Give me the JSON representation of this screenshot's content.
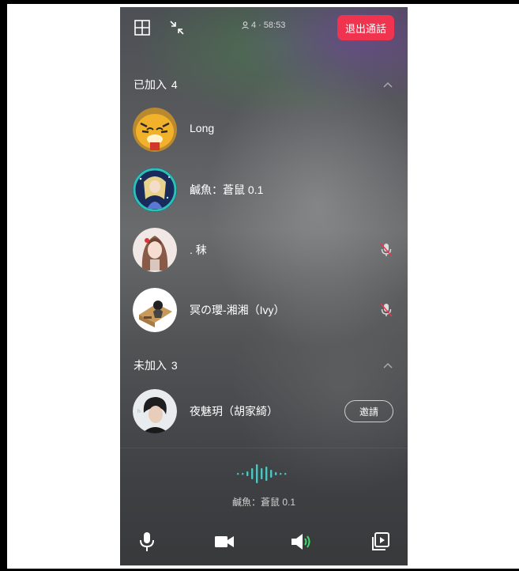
{
  "header": {
    "participants_count": "4",
    "call_duration": "58:53",
    "exit_label": "退出通話"
  },
  "joined": {
    "title": "已加入",
    "count": "4",
    "members": [
      {
        "name": "Long",
        "muted": false
      },
      {
        "name": "鹹魚：蒼鼠 0.1",
        "muted": false
      },
      {
        "name": ". 秣",
        "muted": true
      },
      {
        "name": "冥の瓔-湘湘（Ivy）",
        "muted": true
      }
    ]
  },
  "not_joined": {
    "title": "未加入",
    "count": "3",
    "members": [
      {
        "name": "夜魅玥（胡家綺）",
        "action_label": "邀請"
      }
    ]
  },
  "active_speaker": {
    "name": "鹹魚：蒼鼠 0.1"
  },
  "colors": {
    "accent_red": "#f0334f",
    "wave_teal": "#4cc6c2",
    "speaker_green": "#3ddc6a"
  },
  "icons": {
    "top_left": [
      "grid-view-icon",
      "minimize-icon"
    ],
    "bottom": [
      "microphone-icon",
      "video-camera-icon",
      "speaker-icon",
      "screen-share-icon"
    ]
  }
}
